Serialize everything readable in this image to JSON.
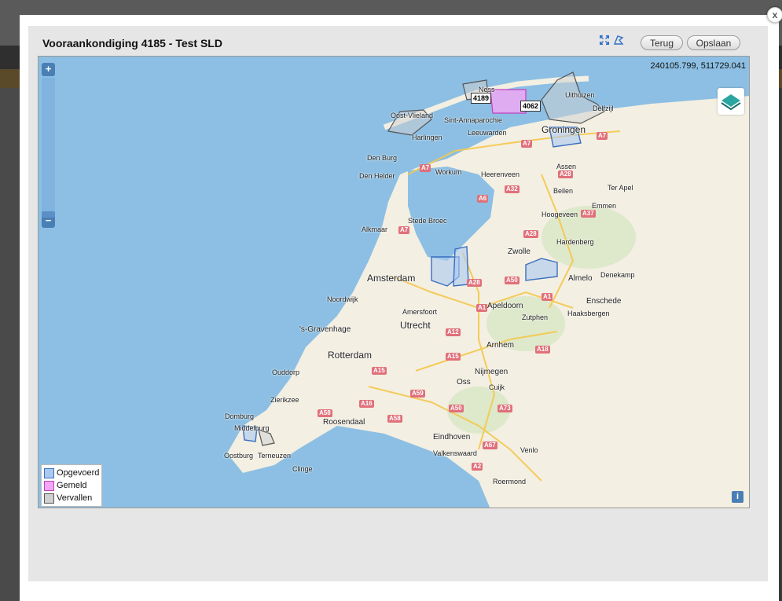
{
  "dialog": {
    "title": "Vooraankondiging 4185 - Test SLD",
    "close_label": "x",
    "back_label": "Terug",
    "save_label": "Opslaan",
    "tools": [
      "expand-icon",
      "draw-polygon-icon"
    ]
  },
  "map": {
    "coordinates": "240105.799, 511729.041",
    "zoom_in_label": "+",
    "zoom_out_label": "−",
    "info_label": "i",
    "tags": [
      "4189",
      "4062"
    ],
    "cities": [
      "Amsterdam",
      "Rotterdam",
      "Utrecht",
      "'s-Gravenhage",
      "Groningen",
      "Zwolle",
      "Arnhem",
      "Nijmegen",
      "Eindhoven",
      "Leeuwarden",
      "Assen",
      "Apeldoorn",
      "Almelo",
      "Enschede",
      "Amersfoort",
      "Alkmaar",
      "Den Helder",
      "Den Burg",
      "Harlingen",
      "Sint-Annaparochie",
      "Oost-Vlieland",
      "Ness",
      "Uithuizen",
      "Delfzijl",
      "Workum",
      "Heerenveen",
      "Beilen",
      "Ter Apel",
      "Emmen",
      "Hoogeveen",
      "Stede Broec",
      "Hardenberg",
      "Denekamp",
      "Haaksbergen",
      "Zutphen",
      "Noordwijk",
      "Ouddorp",
      "Zierikzee",
      "Domburg",
      "Middelburg",
      "Oostburg",
      "Terneuzen",
      "Clinge",
      "Roosendaal",
      "Oss",
      "Cuijk",
      "Valkenswaard",
      "Venlo",
      "Roermond"
    ],
    "roads": [
      "A7",
      "A7",
      "A7",
      "A32",
      "A6",
      "A28",
      "A37",
      "A28",
      "A7",
      "A28",
      "A50",
      "A1",
      "A1",
      "A12",
      "A15",
      "A18",
      "A15",
      "A59",
      "A16",
      "A58",
      "A58",
      "A50",
      "A73",
      "A67",
      "A2"
    ]
  },
  "legend": {
    "items": [
      {
        "label": "Opgevoerd",
        "color": "#aac8f0",
        "border": "#3a6fc0"
      },
      {
        "label": "Gemeld",
        "color": "#f4a6f4",
        "border": "#c040c0"
      },
      {
        "label": "Vervallen",
        "color": "#d0d0d0",
        "border": "#555555"
      }
    ]
  }
}
